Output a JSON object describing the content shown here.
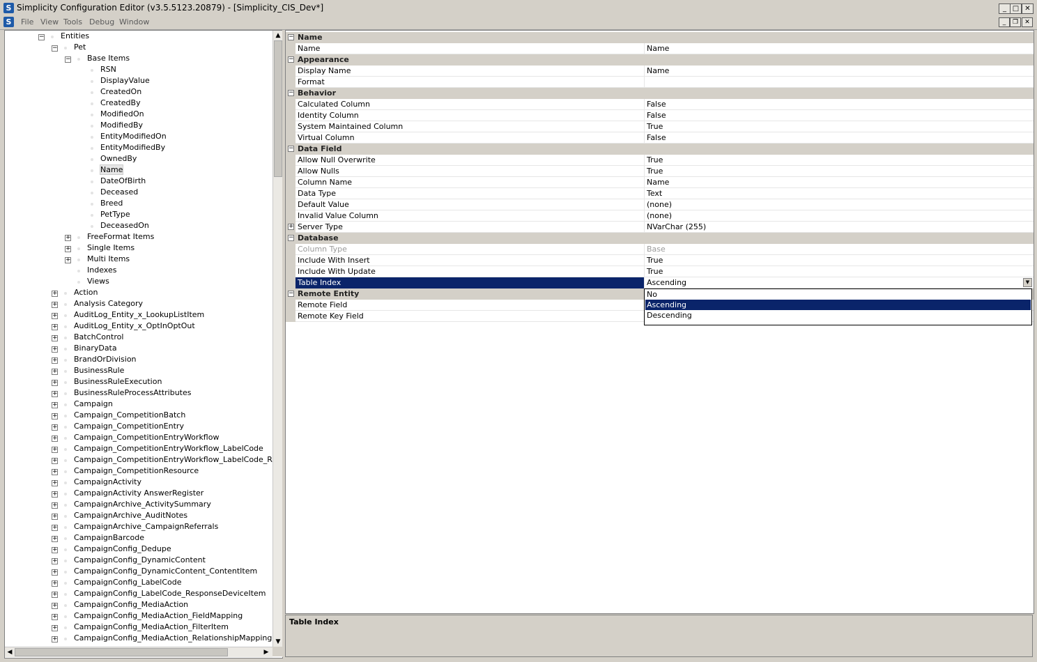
{
  "window": {
    "title": "Simplicity Configuration Editor (v3.5.5123.20879) - [Simplicity_CIS_Dev*]",
    "app_icon": "S"
  },
  "menu": {
    "items": [
      "File",
      "View",
      "Tools",
      "Debug",
      "Window"
    ]
  },
  "tree": {
    "root": "Entities",
    "entity": "Pet",
    "base_items_label": "Base Items",
    "base_items": [
      "RSN",
      "DisplayValue",
      "CreatedOn",
      "CreatedBy",
      "ModifiedOn",
      "ModifiedBy",
      "EntityModifiedOn",
      "EntityModifiedBy",
      "OwnedBy",
      "Name",
      "DateOfBirth",
      "Deceased",
      "Breed",
      "PetType",
      "DeceasedOn"
    ],
    "selected_item": "Name",
    "pet_children": [
      "FreeFormat Items",
      "Single Items",
      "Multi Items",
      "Indexes",
      "Views"
    ],
    "entities": [
      "Action",
      "Analysis Category",
      "AuditLog_Entity_x_LookupListItem",
      "AuditLog_Entity_x_OptInOptOut",
      "BatchControl",
      "BinaryData",
      "BrandOrDivision",
      "BusinessRule",
      "BusinessRuleExecution",
      "BusinessRuleProcessAttributes",
      "Campaign",
      "Campaign_CompetitionBatch",
      "Campaign_CompetitionEntry",
      "Campaign_CompetitionEntryWorkflow",
      "Campaign_CompetitionEntryWorkflow_LabelCode",
      "Campaign_CompetitionEntryWorkflow_LabelCode_Respons",
      "Campaign_CompetitionResource",
      "CampaignActivity",
      "CampaignActivity AnswerRegister",
      "CampaignArchive_ActivitySummary",
      "CampaignArchive_AuditNotes",
      "CampaignArchive_CampaignReferrals",
      "CampaignBarcode",
      "CampaignConfig_Dedupe",
      "CampaignConfig_DynamicContent",
      "CampaignConfig_DynamicContent_ContentItem",
      "CampaignConfig_LabelCode",
      "CampaignConfig_LabelCode_ResponseDeviceItem",
      "CampaignConfig_MediaAction",
      "CampaignConfig_MediaAction_FieldMapping",
      "CampaignConfig_MediaAction_FilterItem",
      "CampaignConfig_MediaAction_RelationshipMapping"
    ]
  },
  "properties": {
    "sections": [
      {
        "category": "Name",
        "rows": [
          {
            "name": "Name",
            "value": "Name"
          }
        ]
      },
      {
        "category": "Appearance",
        "rows": [
          {
            "name": "Display Name",
            "value": "Name"
          },
          {
            "name": "Format",
            "value": ""
          }
        ]
      },
      {
        "category": "Behavior",
        "rows": [
          {
            "name": "Calculated Column",
            "value": "False"
          },
          {
            "name": "Identity Column",
            "value": "False"
          },
          {
            "name": "System Maintained Column",
            "value": "True"
          },
          {
            "name": "Virtual Column",
            "value": "False"
          }
        ]
      },
      {
        "category": "Data Field",
        "rows": [
          {
            "name": "Allow Null Overwrite",
            "value": "True"
          },
          {
            "name": "Allow Nulls",
            "value": "True"
          },
          {
            "name": "Column Name",
            "value": "Name"
          },
          {
            "name": "Data Type",
            "value": "Text"
          },
          {
            "name": "Default Value",
            "value": "(none)"
          },
          {
            "name": "Invalid Value Column",
            "value": "(none)"
          },
          {
            "name": "Server Type",
            "value": "NVarChar (255)",
            "expandable": true
          }
        ]
      },
      {
        "category": "Database",
        "rows": [
          {
            "name": "Column Type",
            "value": "Base",
            "readonly": true
          },
          {
            "name": "Include With Insert",
            "value": "True"
          },
          {
            "name": "Include With Update",
            "value": "True"
          },
          {
            "name": "Table Index",
            "value": "Ascending",
            "selected": true
          }
        ]
      },
      {
        "category": "Remote Entity",
        "rows": [
          {
            "name": "Remote Field",
            "value": ""
          },
          {
            "name": "Remote Key Field",
            "value": ""
          }
        ]
      }
    ],
    "dropdown_options": [
      "No",
      "Ascending",
      "Descending"
    ],
    "dropdown_selected": "Ascending"
  },
  "help": {
    "title": "Table Index"
  },
  "colors": {
    "selection": "#0a246a",
    "chrome": "#d4d0c8"
  }
}
